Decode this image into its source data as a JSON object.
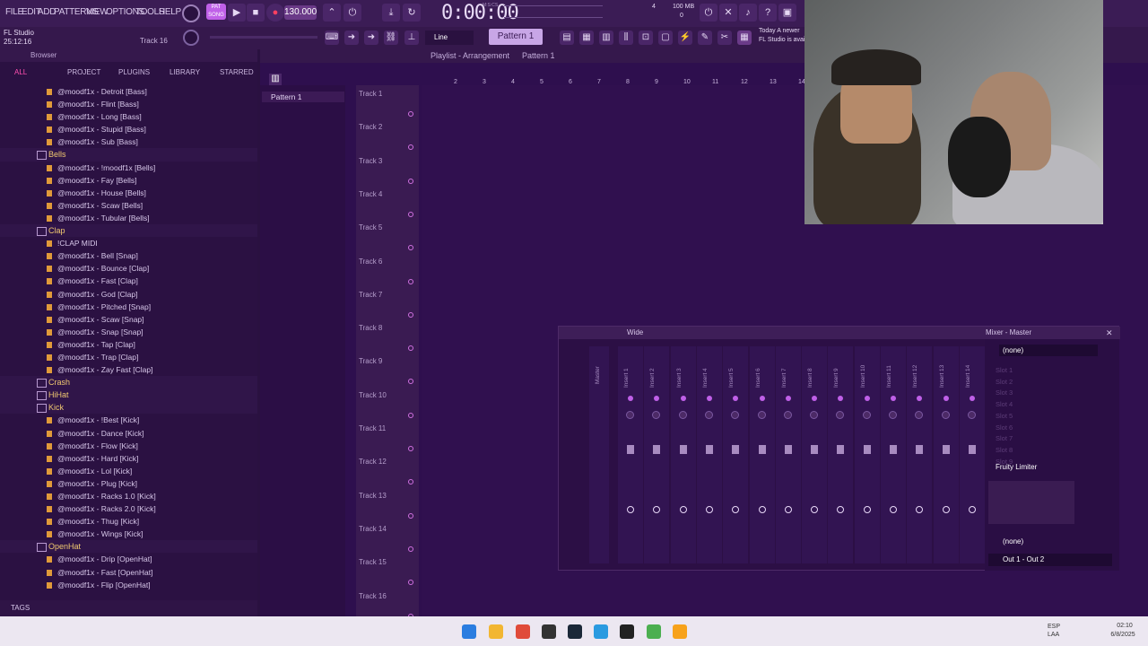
{
  "menu": [
    "FILE",
    "EDIT",
    "ADD",
    "PATTERNS",
    "VIEW",
    "OPTIONS",
    "TOOLS",
    "HELP"
  ],
  "transport": {
    "song_mode": "PAT",
    "bpm": "130.000",
    "time": "0:00:00",
    "time_label": "M:S:CS",
    "memory": "100 MB",
    "cpu": "4",
    "poly": "0"
  },
  "project": {
    "name": "FL Studio",
    "time": "25:12:16",
    "track_label": "Track 16"
  },
  "toolbar2": {
    "snap": "Line",
    "pattern": "Pattern 1"
  },
  "news": [
    "Today  A newer",
    "FL Studio is avai"
  ],
  "browser": {
    "title": "Browser",
    "tabs": [
      "ALL",
      "PROJECT",
      "PLUGINS",
      "LIBRARY",
      "STARRED"
    ],
    "rows": [
      {
        "type": "file",
        "label": "@moodf1x - Detroit [Bass]"
      },
      {
        "type": "file",
        "label": "@moodf1x - Flint [Bass]"
      },
      {
        "type": "file",
        "label": "@moodf1x - Long [Bass]"
      },
      {
        "type": "file",
        "label": "@moodf1x - Stupid [Bass]"
      },
      {
        "type": "file",
        "label": "@moodf1x - Sub [Bass]"
      },
      {
        "type": "folder",
        "label": "Bells"
      },
      {
        "type": "file",
        "label": "@moodf1x - !moodf1x [Bells]"
      },
      {
        "type": "file",
        "label": "@moodf1x - Fay [Bells]"
      },
      {
        "type": "file",
        "label": "@moodf1x - House [Bells]"
      },
      {
        "type": "file",
        "label": "@moodf1x - Scaw [Bells]"
      },
      {
        "type": "file",
        "label": "@moodf1x - Tubular [Bells]"
      },
      {
        "type": "folder",
        "label": "Clap"
      },
      {
        "type": "file",
        "label": "!CLAP MIDI"
      },
      {
        "type": "file",
        "label": "@moodf1x - Bell [Snap]"
      },
      {
        "type": "file",
        "label": "@moodf1x - Bounce [Clap]"
      },
      {
        "type": "file",
        "label": "@moodf1x - Fast [Clap]"
      },
      {
        "type": "file",
        "label": "@moodf1x - God [Clap]"
      },
      {
        "type": "file",
        "label": "@moodf1x - Pitched [Snap]"
      },
      {
        "type": "file",
        "label": "@moodf1x - Scaw [Snap]"
      },
      {
        "type": "file",
        "label": "@moodf1x - Snap [Snap]"
      },
      {
        "type": "file",
        "label": "@moodf1x - Tap [Clap]"
      },
      {
        "type": "file",
        "label": "@moodf1x - Trap [Clap]"
      },
      {
        "type": "file",
        "label": "@moodf1x - Zay Fast [Clap]"
      },
      {
        "type": "folder",
        "label": "Crash"
      },
      {
        "type": "folder",
        "label": "HiHat"
      },
      {
        "type": "folder",
        "label": "Kick"
      },
      {
        "type": "file",
        "label": "@moodf1x - !Best [Kick]"
      },
      {
        "type": "file",
        "label": "@moodf1x - Dance [Kick]"
      },
      {
        "type": "file",
        "label": "@moodf1x - Flow [Kick]"
      },
      {
        "type": "file",
        "label": "@moodf1x - Hard [Kick]"
      },
      {
        "type": "file",
        "label": "@moodf1x - Lol [Kick]"
      },
      {
        "type": "file",
        "label": "@moodf1x - Plug [Kick]"
      },
      {
        "type": "file",
        "label": "@moodf1x - Racks 1.0 [Kick]"
      },
      {
        "type": "file",
        "label": "@moodf1x - Racks 2.0 [Kick]"
      },
      {
        "type": "file",
        "label": "@moodf1x - Thug [Kick]"
      },
      {
        "type": "file",
        "label": "@moodf1x - Wings [Kick]"
      },
      {
        "type": "folder",
        "label": "OpenHat"
      },
      {
        "type": "file",
        "label": "@moodf1x - Drip [OpenHat]"
      },
      {
        "type": "file",
        "label": "@moodf1x - Fast [OpenHat]"
      },
      {
        "type": "file",
        "label": "@moodf1x - Flip [OpenHat]"
      }
    ],
    "tags": "TAGS"
  },
  "playlist": {
    "breadcrumb": "Playlist - Arrangement",
    "pattern": "Pattern 1",
    "pattern_item": "Pattern 1",
    "tracks": [
      "Track 1",
      "Track 2",
      "Track 3",
      "Track 4",
      "Track 5",
      "Track 6",
      "Track 7",
      "Track 8",
      "Track 9",
      "Track 10",
      "Track 11",
      "Track 12",
      "Track 13",
      "Track 14",
      "Track 15",
      "Track 16"
    ],
    "ruler": [
      "2",
      "3",
      "4",
      "5",
      "6",
      "7",
      "8",
      "9",
      "10",
      "11",
      "12",
      "13",
      "14"
    ]
  },
  "mixer": {
    "title": "Mixer - Master",
    "view": "Wide",
    "master_label": "Master",
    "inserts": [
      "Insert 1",
      "Insert 2",
      "Insert 3",
      "Insert 4",
      "Insert 5",
      "Insert 6",
      "Insert 7",
      "Insert 8",
      "Insert 9",
      "Insert 10",
      "Insert 11",
      "Insert 12",
      "Insert 13",
      "Insert 14"
    ],
    "preset": "(none)",
    "slots": [
      "Slot 1",
      "Slot 2",
      "Slot 3",
      "Slot 4",
      "Slot 5",
      "Slot 6",
      "Slot 7",
      "Slot 8",
      "Slot 9"
    ],
    "limiter": "Fruity Limiter",
    "eq_preset": "(none)",
    "output": "Out 1 - Out 2"
  },
  "taskbar": {
    "lang": "ESP",
    "layout": "LAA",
    "time": "02:10",
    "date": "6/8/2025"
  },
  "colors": {
    "accent": "#c060e8",
    "folder": "#f0c870",
    "background": "#2e0f4e"
  }
}
